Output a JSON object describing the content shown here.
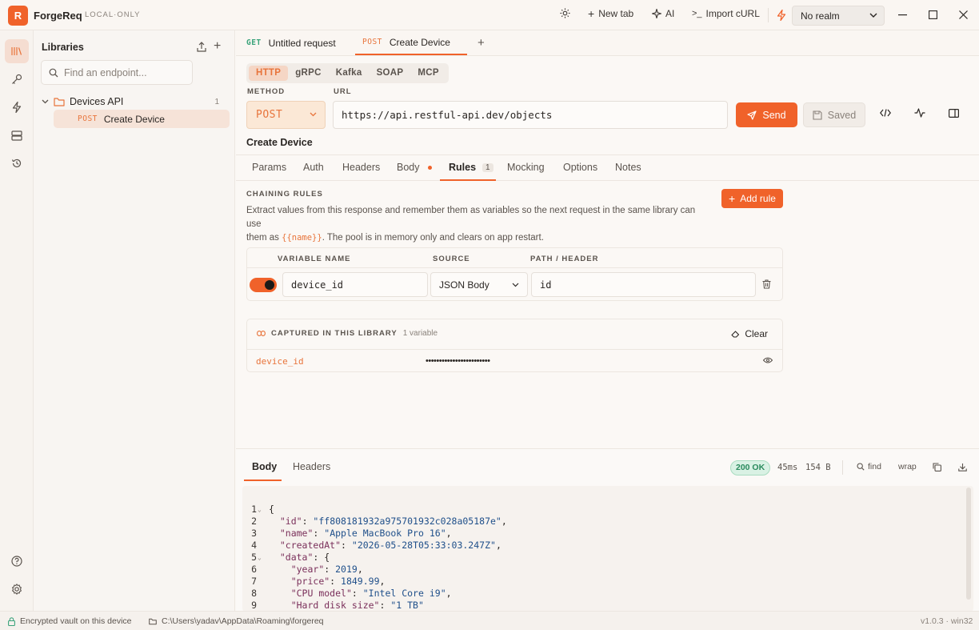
{
  "app": {
    "logo_letter": "R",
    "name": "ForgeReq",
    "mode": "LOCAL·ONLY"
  },
  "titlebar": {
    "new_tab": "New tab",
    "ai": "AI",
    "import_curl": "Import cURL",
    "realm": "No realm"
  },
  "sidebar": {
    "title": "Libraries",
    "search_placeholder": "Find an endpoint...",
    "folder": {
      "name": "Devices API",
      "count": "1"
    },
    "item": {
      "method": "POST",
      "name": "Create Device"
    }
  },
  "tabs": [
    {
      "method": "GET",
      "name": "Untitled request"
    },
    {
      "method": "POST",
      "name": "Create Device"
    }
  ],
  "request": {
    "protocols": [
      "HTTP",
      "gRPC",
      "Kafka",
      "SOAP",
      "MCP"
    ],
    "method_label": "METHOD",
    "url_label": "URL",
    "method": "POST",
    "url": "https://api.restful-api.dev/objects",
    "send": "Send",
    "saved": "Saved",
    "name": "Create Device",
    "subtabs": [
      "Params",
      "Auth",
      "Headers",
      "Body",
      "Rules",
      "Mocking",
      "Options",
      "Notes"
    ],
    "rules_count": "1"
  },
  "rules": {
    "section_title": "CHAINING RULES",
    "desc_1": "Extract values from this response and remember them as variables so the next request in the same library can use",
    "desc_2a": "them as",
    "desc_var": "{{name}}",
    "desc_2b": ". The pool is in memory only and clears on app restart.",
    "add_rule": "Add rule",
    "columns": [
      "VARIABLE NAME",
      "SOURCE",
      "PATH / HEADER"
    ],
    "row": {
      "variable": "device_id",
      "source": "JSON Body",
      "path": "id",
      "enabled": true
    }
  },
  "captured": {
    "title": "CAPTURED IN THIS LIBRARY",
    "count": "1 variable",
    "clear": "Clear",
    "var_name": "device_id",
    "var_value": "••••••••••••••••••••••••"
  },
  "response": {
    "tabs": [
      "Body",
      "Headers"
    ],
    "status": "200 OK",
    "time": "45ms",
    "size": "154 B",
    "find": "find",
    "wrap": "wrap",
    "lines": [
      {
        "n": "1",
        "fold": true
      },
      {
        "n": "2"
      },
      {
        "n": "3"
      },
      {
        "n": "4"
      },
      {
        "n": "5",
        "fold": true
      },
      {
        "n": "6"
      },
      {
        "n": "7"
      },
      {
        "n": "8"
      },
      {
        "n": "9"
      }
    ],
    "json": {
      "id": "ff808181932a975701932c028a05187e",
      "name": "Apple MacBook Pro 16",
      "createdAt": "2026-05-28T05:33:03.247Z",
      "year": "2019",
      "price": "1849.99",
      "cpu": "Intel Core i9",
      "disk": "1 TB"
    }
  },
  "statusbar": {
    "vault": "Encrypted vault on this device",
    "path": "C:\\Users\\yadav\\AppData\\Roaming\\forgereq",
    "version": "v1.0.3 · win32"
  },
  "colors": {
    "accent": "#f0622a",
    "success": "#2a8a5d"
  }
}
